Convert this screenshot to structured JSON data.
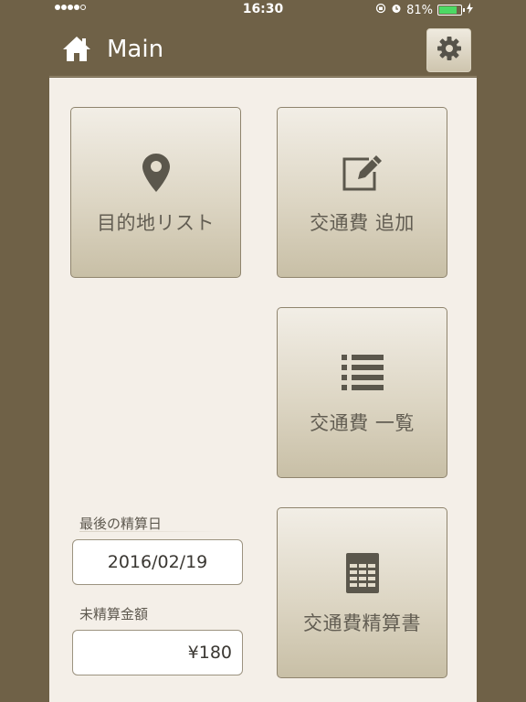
{
  "status_bar": {
    "time": "16:30",
    "battery_percent": "81%",
    "battery_level": 0.81,
    "signal_bars_filled": 4,
    "signal_bars_total": 5
  },
  "nav": {
    "title": "Main",
    "home_icon": "home-icon",
    "settings_icon": "gear-icon"
  },
  "tiles": {
    "destination_list": {
      "label": "目的地リスト",
      "icon": "map-pin-icon"
    },
    "add_expense": {
      "label": "交通費 追加",
      "icon": "edit-icon"
    },
    "expense_list": {
      "label": "交通費 一覧",
      "icon": "list-icon"
    },
    "expense_report": {
      "label": "交通費精算書",
      "icon": "spreadsheet-icon"
    }
  },
  "summary": {
    "last_settlement_label": "最後の精算日",
    "last_settlement_value": "2016/02/19",
    "unsettled_label": "未精算金額",
    "unsettled_value": "¥180"
  },
  "colors": {
    "frame": "#6f6147",
    "content_bg": "#f4efe8",
    "icon": "#5b574c",
    "battery": "#4cd964"
  }
}
